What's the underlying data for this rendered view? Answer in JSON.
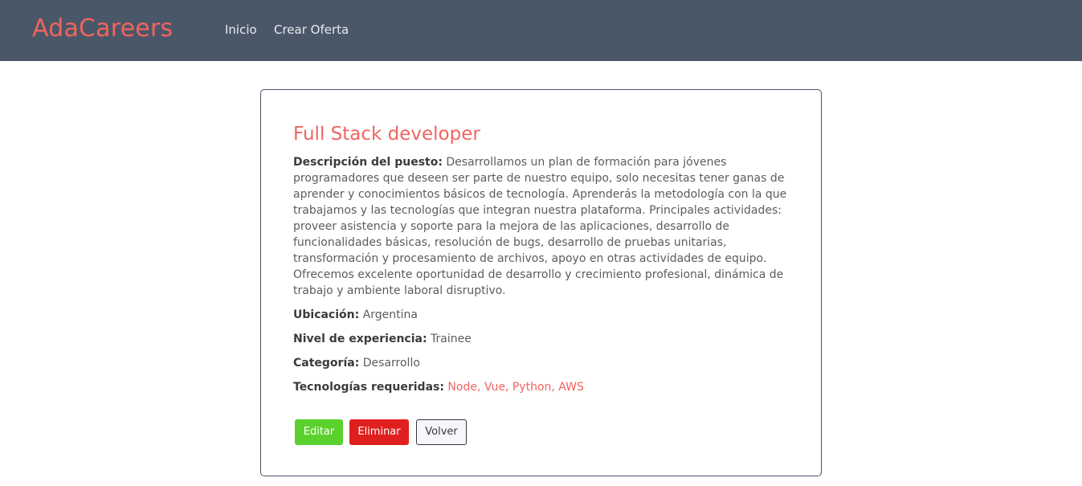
{
  "navbar": {
    "brand": "AdaCareers",
    "links": [
      {
        "label": "Inicio"
      },
      {
        "label": "Crear Oferta"
      }
    ],
    "background_color": "#4a5768",
    "brand_color": "#f0645f"
  },
  "job": {
    "title": "Full Stack developer",
    "description_label": "Descripción del puesto:",
    "description": "Desarrollamos un plan de formación para jóvenes programadores que deseen ser parte de nuestro equipo, solo necesitas tener ganas de aprender y conocimientos básicos de tecnología. Aprenderás la metodología con la que trabajamos y las tecnologías que integran nuestra plataforma. Principales actividades: proveer asistencia y soporte para la mejora de las aplicaciones, desarrollo de funcionalidades básicas, resolución de bugs, desarrollo de pruebas unitarias, transformación y procesamiento de archivos, apoyo en otras actividades de equipo. Ofrecemos excelente oportunidad de desarrollo y crecimiento profesional, dinámica de trabajo y ambiente laboral disruptivo.",
    "location_label": "Ubicación:",
    "location": "Argentina",
    "experience_label": "Nivel de experiencia:",
    "experience": "Trainee",
    "category_label": "Categoría:",
    "category": "Desarrollo",
    "technologies_label": "Tecnologías requeridas:",
    "technologies": "Node, Vue, Python, AWS"
  },
  "actions": {
    "edit_label": "Editar",
    "delete_label": "Eliminar",
    "back_label": "Volver",
    "edit_color": "#5bd12d",
    "delete_color": "#e0201f"
  }
}
